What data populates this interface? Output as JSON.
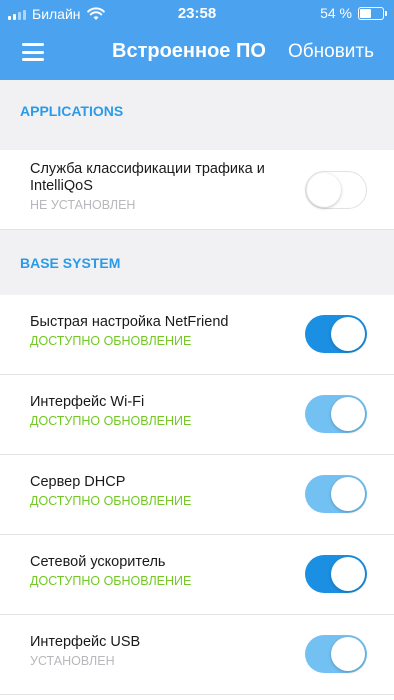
{
  "status_bar": {
    "carrier": "Билайн",
    "time": "23:58",
    "battery_percent": "54 %",
    "battery_level": 0.54
  },
  "nav": {
    "title": "Встроенное ПО",
    "update_label": "Обновить"
  },
  "sections": [
    {
      "title": "APPLICATIONS",
      "items": [
        {
          "title": "Служба классификации трафика и IntelliQoS",
          "status": "НЕ УСТАНОВЛЕН",
          "status_style": "gray",
          "toggle": "off"
        }
      ]
    },
    {
      "title": "BASE SYSTEM",
      "items": [
        {
          "title": "Быстрая настройка NetFriend",
          "status": "ДОСТУПНО ОБНОВЛЕНИЕ",
          "status_style": "green",
          "toggle": "on-dark"
        },
        {
          "title": "Интерфейс Wi-Fi",
          "status": "ДОСТУПНО ОБНОВЛЕНИЕ",
          "status_style": "green",
          "toggle": "on-light"
        },
        {
          "title": "Сервер DHCP",
          "status": "ДОСТУПНО ОБНОВЛЕНИЕ",
          "status_style": "green",
          "toggle": "on-light"
        },
        {
          "title": "Сетевой ускоритель",
          "status": "ДОСТУПНО ОБНОВЛЕНИЕ",
          "status_style": "green",
          "toggle": "on-dark"
        },
        {
          "title": "Интерфейс USB",
          "status": "УСТАНОВЛЕН",
          "status_style": "gray",
          "toggle": "on-light"
        }
      ]
    }
  ],
  "colors": {
    "header_bg": "#4ba2ee",
    "section_title": "#2a9be8",
    "status_green": "#73c826",
    "toggle_on_dark": "#1b8fe2",
    "toggle_on_light": "#73c1f2"
  }
}
